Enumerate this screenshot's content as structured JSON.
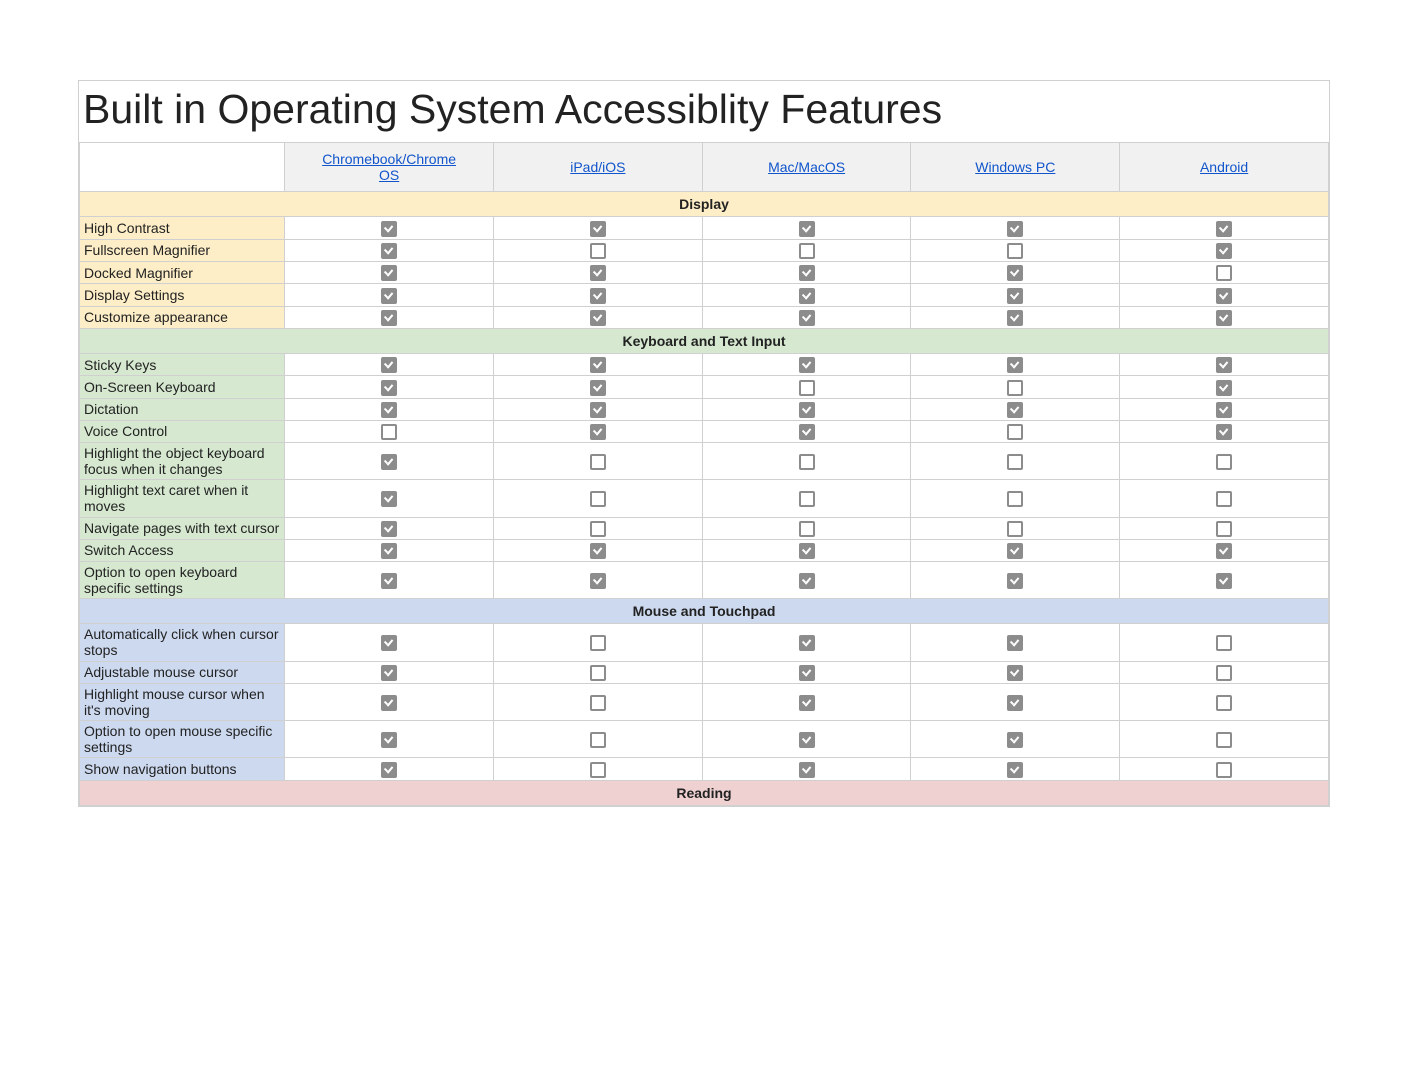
{
  "title": "Built in Operating System Accessiblity Features",
  "columns": [
    {
      "label_line1": "Chromebook/Chrome",
      "label_line2": "OS"
    },
    {
      "label_line1": "iPad/iOS",
      "label_line2": ""
    },
    {
      "label_line1": "Mac/MacOS",
      "label_line2": ""
    },
    {
      "label_line1": "Windows PC",
      "label_line2": ""
    },
    {
      "label_line1": "Android",
      "label_line2": ""
    }
  ],
  "colors": {
    "display": "#fdeec7",
    "keyboard": "#d6e8d0",
    "mouse": "#cdd9ef",
    "reading": "#f0d1d1"
  },
  "sections": [
    {
      "title": "Display",
      "tint": "t-yellow",
      "rows": [
        {
          "label": "High Contrast",
          "v": [
            true,
            true,
            true,
            true,
            true
          ]
        },
        {
          "label": "Fullscreen Magnifier",
          "v": [
            true,
            false,
            false,
            false,
            true
          ]
        },
        {
          "label": "Docked Magnifier",
          "v": [
            true,
            true,
            true,
            true,
            false
          ]
        },
        {
          "label": "Display Settings",
          "v": [
            true,
            true,
            true,
            true,
            true
          ]
        },
        {
          "label": "Customize appearance",
          "v": [
            true,
            true,
            true,
            true,
            true
          ]
        }
      ]
    },
    {
      "title": "Keyboard and Text Input",
      "tint": "t-green",
      "rows": [
        {
          "label": "Sticky Keys",
          "v": [
            true,
            true,
            true,
            true,
            true
          ]
        },
        {
          "label": "On-Screen Keyboard",
          "v": [
            true,
            true,
            false,
            false,
            true
          ]
        },
        {
          "label": "Dictation",
          "v": [
            true,
            true,
            true,
            true,
            true
          ]
        },
        {
          "label": "Voice Control",
          "v": [
            false,
            true,
            true,
            false,
            true
          ]
        },
        {
          "label": "Highlight the object keyboard focus when it changes",
          "v": [
            true,
            false,
            false,
            false,
            false
          ]
        },
        {
          "label": "Highlight text caret when it moves",
          "v": [
            true,
            false,
            false,
            false,
            false
          ]
        },
        {
          "label": "Navigate pages with text cursor",
          "v": [
            true,
            false,
            false,
            false,
            false
          ]
        },
        {
          "label": "Switch Access",
          "v": [
            true,
            true,
            true,
            true,
            true
          ]
        },
        {
          "label": "Option to open keyboard specific settings",
          "v": [
            true,
            true,
            true,
            true,
            true
          ]
        }
      ]
    },
    {
      "title": "Mouse and Touchpad",
      "tint": "t-blue",
      "rows": [
        {
          "label": "Automatically click when cursor stops",
          "v": [
            true,
            false,
            true,
            true,
            false
          ]
        },
        {
          "label": "Adjustable mouse cursor",
          "v": [
            true,
            false,
            true,
            true,
            false
          ]
        },
        {
          "label": "Highlight mouse cursor when it's moving",
          "v": [
            true,
            false,
            true,
            true,
            false
          ]
        },
        {
          "label": "Option to open mouse specific settings",
          "v": [
            true,
            false,
            true,
            true,
            false
          ]
        },
        {
          "label": "Show navigation buttons",
          "v": [
            true,
            false,
            true,
            true,
            false
          ]
        }
      ]
    },
    {
      "title": "Reading",
      "tint": "t-pink",
      "rows": []
    }
  ]
}
